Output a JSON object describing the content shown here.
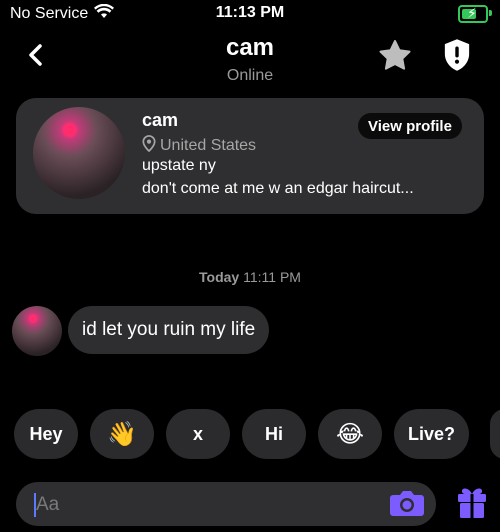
{
  "status": {
    "carrier": "No Service",
    "time": "11:13 PM"
  },
  "header": {
    "title": "cam",
    "subtitle": "Online"
  },
  "profile": {
    "name": "cam",
    "location": "United States",
    "bio_line1": "upstate ny",
    "bio_line2": "don't come at me w an edgar haircut...",
    "view_label": "View profile"
  },
  "chat": {
    "day": "Today",
    "time": "11:11 PM",
    "messages": [
      {
        "text": "id let you ruin my life"
      }
    ]
  },
  "quick_replies": [
    "Hey",
    "👋",
    "x",
    "Hi",
    "😂",
    "Live?"
  ],
  "composer": {
    "placeholder": "Aa"
  },
  "colors": {
    "accent": "#7c5cff",
    "battery": "#34c759",
    "background": "#000000",
    "card": "#2f2f31"
  }
}
